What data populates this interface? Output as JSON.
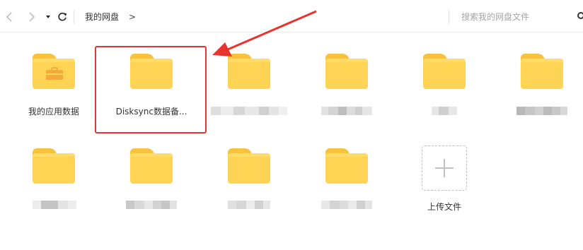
{
  "toolbar": {
    "breadcrumb": {
      "root": "我的网盘",
      "separator": ">"
    },
    "search": {
      "placeholder": "搜索我的网盘文件"
    },
    "icons": {
      "back": "chevron-left-icon",
      "forward": "chevron-right-icon",
      "history": "caret-down-icon",
      "refresh": "refresh-icon",
      "search": "search-icon"
    }
  },
  "items": [
    {
      "label": "我的应用数据",
      "type": "app-folder",
      "redacted": false
    },
    {
      "label": "Disksync数据备...",
      "type": "folder",
      "redacted": false,
      "highlighted": true
    },
    {
      "label": "",
      "type": "folder",
      "redacted": true
    },
    {
      "label": "",
      "type": "folder",
      "redacted": true
    },
    {
      "label": "",
      "type": "folder",
      "redacted": true
    },
    {
      "label": "",
      "type": "folder",
      "redacted": true
    },
    {
      "label": "",
      "type": "folder",
      "redacted": true
    },
    {
      "label": "",
      "type": "folder",
      "redacted": true
    },
    {
      "label": "",
      "type": "folder",
      "redacted": true
    },
    {
      "label": "",
      "type": "folder",
      "redacted": true
    }
  ],
  "upload": {
    "label": "上传文件",
    "icon": "plus-icon"
  },
  "colors": {
    "folder_body": "#ffd454",
    "folder_tab": "#f7c33c",
    "toolbox": "#f6a93b",
    "highlight": "#e8332e"
  }
}
